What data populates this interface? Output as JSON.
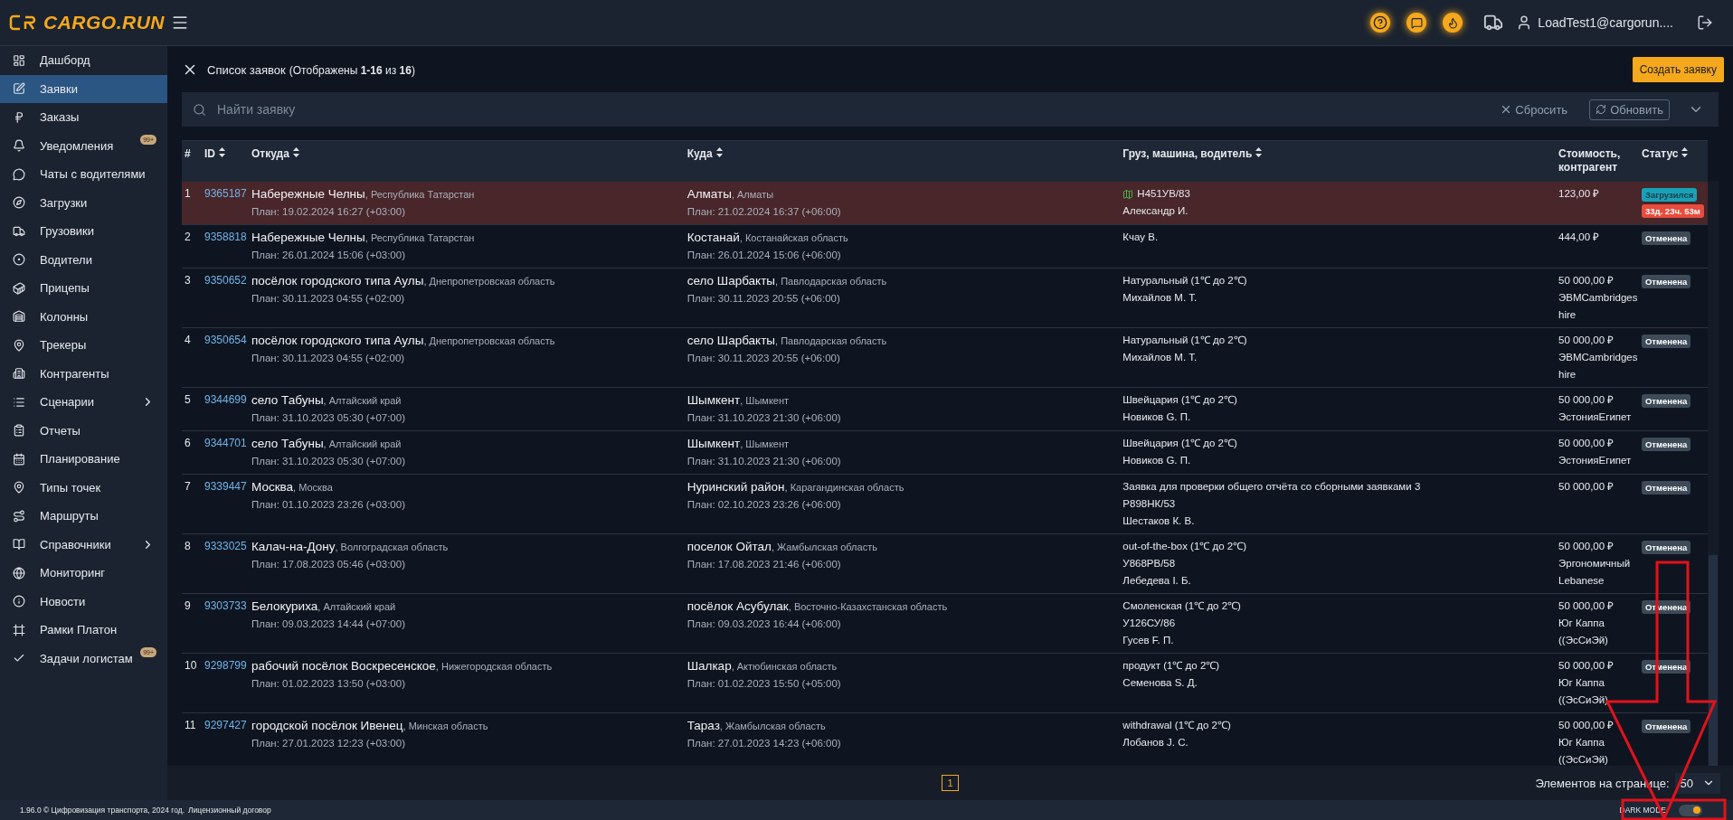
{
  "logo": {
    "text": "CARGO.RUN"
  },
  "topbar": {
    "user": "LoadTest1@cargorun...."
  },
  "sidebar": {
    "items": [
      {
        "label": "Дашборд",
        "selected": false,
        "submenu": false
      },
      {
        "label": "Заявки",
        "selected": true,
        "submenu": false
      },
      {
        "label": "Заказы",
        "selected": false,
        "submenu": false
      },
      {
        "label": "Уведомления",
        "selected": false,
        "submenu": false,
        "badge": "99+"
      },
      {
        "label": "Чаты с водителями",
        "selected": false,
        "submenu": false
      },
      {
        "label": "Загрузки",
        "selected": false,
        "submenu": false
      },
      {
        "label": "Грузовики",
        "selected": false,
        "submenu": false
      },
      {
        "label": "Водители",
        "selected": false,
        "submenu": false
      },
      {
        "label": "Прицепы",
        "selected": false,
        "submenu": false
      },
      {
        "label": "Колонны",
        "selected": false,
        "submenu": false
      },
      {
        "label": "Трекеры",
        "selected": false,
        "submenu": false
      },
      {
        "label": "Контрагенты",
        "selected": false,
        "submenu": false
      },
      {
        "label": "Сценарии",
        "selected": false,
        "submenu": true
      },
      {
        "label": "Отчеты",
        "selected": false,
        "submenu": false
      },
      {
        "label": "Планирование",
        "selected": false,
        "submenu": false
      },
      {
        "label": "Типы точек",
        "selected": false,
        "submenu": false
      },
      {
        "label": "Маршруты",
        "selected": false,
        "submenu": false
      },
      {
        "label": "Справочники",
        "selected": false,
        "submenu": true
      },
      {
        "label": "Мониторинг",
        "selected": false,
        "submenu": false
      },
      {
        "label": "Новости",
        "selected": false,
        "submenu": false
      },
      {
        "label": "Рамки Платон",
        "selected": false,
        "submenu": false
      },
      {
        "label": "Задачи логистам",
        "selected": false,
        "submenu": false,
        "badge": "99+"
      }
    ]
  },
  "page": {
    "title": "Список заявок",
    "subtitle": "(Отображены **1-16** из **16**)",
    "create_button": "Создать заявку"
  },
  "search": {
    "placeholder": "Найти заявку",
    "reset": "Сбросить",
    "refresh": "Обновить"
  },
  "table": {
    "columns": [
      {
        "label": "#",
        "sortable": false
      },
      {
        "label": "ID",
        "sortable": true
      },
      {
        "label": "Откуда",
        "sortable": true
      },
      {
        "label": "Куда",
        "sortable": true
      },
      {
        "label": "Груз, машина, водитель",
        "sortable": true
      },
      {
        "label": "Стоимость, контрагент",
        "sortable": false
      },
      {
        "label": "Статус",
        "sortable": true
      }
    ],
    "rows": [
      {
        "num": "1",
        "id": "9365187",
        "highlighted": true,
        "from": {
          "city": "Набережные Челны",
          "region": ", Республика Татарстан",
          "plan": "План: 19.02.2024 16:27 (+03:00)"
        },
        "to": {
          "city": "Алматы",
          "region": ", Алматы",
          "plan": "План: 21.02.2024 16:37 (+06:00)"
        },
        "tracked": true,
        "cargo": [
          "H451УВ/83",
          "Александр И."
        ],
        "cost": [
          "123,00 ₽"
        ],
        "status": {
          "label": "Загрузился",
          "kind": "loaded"
        },
        "timer": "33д. 23ч. 53м"
      },
      {
        "num": "2",
        "id": "9358818",
        "highlighted": false,
        "from": {
          "city": "Набережные Челны",
          "region": ", Республика Татарстан",
          "plan": "План: 26.01.2024 15:06 (+03:00)"
        },
        "to": {
          "city": "Костанай",
          "region": ", Костанайская область",
          "plan": "План: 26.01.2024 15:06 (+06:00)"
        },
        "tracked": false,
        "cargo": [
          "Кчау В."
        ],
        "cost": [
          "444,00 ₽"
        ],
        "status": {
          "label": "Отменена",
          "kind": "cancelled"
        }
      },
      {
        "num": "3",
        "id": "9350652",
        "highlighted": false,
        "from": {
          "city": "посёлок городского типа Аулы",
          "region": ", Днепропетровская область",
          "plan": "План: 30.11.2023 04:55 (+02:00)"
        },
        "to": {
          "city": "село Шарбакты",
          "region": ", Павлодарская область",
          "plan": "План: 30.11.2023 20:55 (+06:00)"
        },
        "tracked": false,
        "cargo": [
          "Натуральный (1℃ до 2℃)",
          "Михайлов М. Т."
        ],
        "cost": [
          "50 000,00 ₽",
          "ЭВМCambridgeshire"
        ],
        "status": {
          "label": "Отменена",
          "kind": "cancelled"
        }
      },
      {
        "num": "4",
        "id": "9350654",
        "highlighted": false,
        "from": {
          "city": "посёлок городского типа Аулы",
          "region": ", Днепропетровская область",
          "plan": "План: 30.11.2023 04:55 (+02:00)"
        },
        "to": {
          "city": "село Шарбакты",
          "region": ", Павлодарская область",
          "plan": "План: 30.11.2023 20:55 (+06:00)"
        },
        "tracked": false,
        "cargo": [
          "Натуральный (1℃ до 2℃)",
          "Михайлов М. Т."
        ],
        "cost": [
          "50 000,00 ₽",
          "ЭВМCambridgeshire"
        ],
        "status": {
          "label": "Отменена",
          "kind": "cancelled"
        }
      },
      {
        "num": "5",
        "id": "9344699",
        "highlighted": false,
        "from": {
          "city": "село Табуны",
          "region": ", Алтайский край",
          "plan": "План: 31.10.2023 05:30 (+07:00)"
        },
        "to": {
          "city": "Шымкент",
          "region": ", Шымкент",
          "plan": "План: 31.10.2023 21:30 (+06:00)"
        },
        "tracked": false,
        "cargo": [
          "Швейцария (1℃ до 2℃)",
          "Новиков G. П."
        ],
        "cost": [
          "50 000,00 ₽",
          "ЭстонияЕгипет"
        ],
        "status": {
          "label": "Отменена",
          "kind": "cancelled"
        }
      },
      {
        "num": "6",
        "id": "9344701",
        "highlighted": false,
        "from": {
          "city": "село Табуны",
          "region": ", Алтайский край",
          "plan": "План: 31.10.2023 05:30 (+07:00)"
        },
        "to": {
          "city": "Шымкент",
          "region": ", Шымкент",
          "plan": "План: 31.10.2023 21:30 (+06:00)"
        },
        "tracked": false,
        "cargo": [
          "Швейцария (1℃ до 2℃)",
          "Новиков G. П."
        ],
        "cost": [
          "50 000,00 ₽",
          "ЭстонияЕгипет"
        ],
        "status": {
          "label": "Отменена",
          "kind": "cancelled"
        }
      },
      {
        "num": "7",
        "id": "9339447",
        "highlighted": false,
        "from": {
          "city": "Москва",
          "region": ", Москва",
          "plan": "План: 01.10.2023 23:26 (+03:00)"
        },
        "to": {
          "city": "Нуринский район",
          "region": ", Карагандинская область",
          "plan": "План: 02.10.2023 23:26 (+06:00)"
        },
        "tracked": false,
        "cargo": [
          "Заявка для проверки общего отчёта со сборными заявками 3",
          "Р898НК/53",
          "Шестаков К. В."
        ],
        "cost": [
          "50 000,00 ₽"
        ],
        "status": {
          "label": "Отменена",
          "kind": "cancelled"
        }
      },
      {
        "num": "8",
        "id": "9333025",
        "highlighted": false,
        "from": {
          "city": "Калач-на-Дону",
          "region": ", Волгоградская область",
          "plan": "План: 17.08.2023 05:46 (+03:00)"
        },
        "to": {
          "city": "поселок Ойтал",
          "region": ", Жамбылская область",
          "plan": "План: 17.08.2023 21:46 (+06:00)"
        },
        "tracked": false,
        "cargo": [
          "out-of-the-box (1℃ до 2℃)",
          "У868РВ/58",
          "Лебедева I. Б."
        ],
        "cost": [
          "50 000,00 ₽",
          "Эргономичный Lebanese"
        ],
        "status": {
          "label": "Отменена",
          "kind": "cancelled"
        }
      },
      {
        "num": "9",
        "id": "9303733",
        "highlighted": false,
        "from": {
          "city": "Белокуриха",
          "region": ", Алтайский край",
          "plan": "План: 09.03.2023 14:44 (+07:00)"
        },
        "to": {
          "city": "посёлок Асубулак",
          "region": ", Восточно-Казахстанская область",
          "plan": "План: 09.03.2023 16:44 (+06:00)"
        },
        "tracked": false,
        "cargo": [
          "Смоленская (1℃ до 2℃)",
          "У126СУ/86",
          "Гусев F. П."
        ],
        "cost": [
          "50 000,00 ₽",
          "Юг Каппа ((ЭсСиЭй)"
        ],
        "status": {
          "label": "Отменена",
          "kind": "cancelled"
        }
      },
      {
        "num": "10",
        "id": "9298799",
        "highlighted": false,
        "from": {
          "city": "рабочий посёлок Воскресенское",
          "region": ", Нижегородская область",
          "plan": "План: 01.02.2023 13:50 (+03:00)"
        },
        "to": {
          "city": "Шалкар",
          "region": ", Актюбинская область",
          "plan": "План: 01.02.2023 15:50 (+05:00)"
        },
        "tracked": false,
        "cargo": [
          "продукт (1℃ до 2℃)",
          "Семенова S. Д."
        ],
        "cost": [
          "50 000,00 ₽",
          "Юг Каппа ((ЭсСиЭй)"
        ],
        "status": {
          "label": "Отменена",
          "kind": "cancelled"
        }
      },
      {
        "num": "11",
        "id": "9297427",
        "highlighted": false,
        "from": {
          "city": "городской посёлок Ивенец",
          "region": ", Минская область",
          "plan": "План: 27.01.2023 12:23 (+03:00)"
        },
        "to": {
          "city": "Тараз",
          "region": ", Жамбылская область",
          "plan": "План: 27.01.2023 14:23 (+06:00)"
        },
        "tracked": false,
        "cargo": [
          "withdrawal (1℃ до 2℃)",
          "Лобанов J. C."
        ],
        "cost": [
          "50 000,00 ₽",
          "Юг Каппа ((ЭсСиЭй)"
        ],
        "status": {
          "label": "Отменена",
          "kind": "cancelled"
        }
      }
    ]
  },
  "pagination": {
    "pages": [
      {
        "label": "1",
        "selected": true
      }
    ],
    "per_page_label": "Элементов на странице:",
    "per_page": "50"
  },
  "footer": {
    "copyright": "1.96.0 © Цифровизация транспорта, 2024 год.",
    "license_link": "Лицензионный договор",
    "dark_mode": {
      "label": "DARK MODE",
      "on": true
    }
  }
}
